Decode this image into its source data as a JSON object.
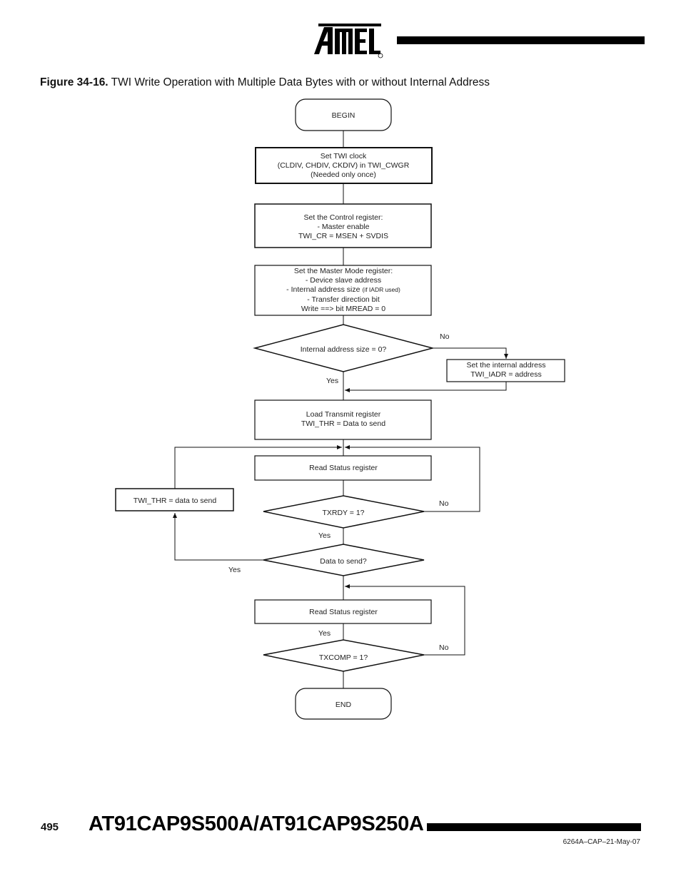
{
  "header": {
    "logo_text": "ATMEL",
    "logo_icon": "atmel-logo-icon",
    "registered_mark": "®"
  },
  "figure": {
    "label": "Figure 34-16.",
    "title": "TWI Write Operation with Multiple Data Bytes with or without Internal Address"
  },
  "flowchart": {
    "nodes": {
      "begin": {
        "type": "terminator",
        "lines": [
          "BEGIN"
        ]
      },
      "set_clock": {
        "type": "process",
        "lines": [
          "Set TWI clock",
          "(CLDIV, CHDIV, CKDIV) in TWI_CWGR",
          "(Needed only once)"
        ]
      },
      "set_control": {
        "type": "process",
        "lines": [
          "Set the Control register:",
          "- Master enable",
          "TWI_CR = MSEN + SVDIS"
        ]
      },
      "set_master_mode": {
        "type": "process",
        "lines": [
          "Set the Master Mode register:",
          "- Device slave address",
          "- Internal address size",
          "- Transfer direction bit",
          "Write ==> bit MREAD = 0"
        ],
        "small_note": "(if IADR used)"
      },
      "dec_internal_addr": {
        "type": "decision",
        "lines": [
          "Internal address size = 0?"
        ]
      },
      "set_internal_addr": {
        "type": "process",
        "lines": [
          "Set the internal address",
          "TWI_IADR = address"
        ]
      },
      "load_thr": {
        "type": "process",
        "lines": [
          "Load Transmit register",
          "TWI_THR = Data to send"
        ]
      },
      "read_status_1": {
        "type": "process",
        "lines": [
          "Read Status register"
        ]
      },
      "thr_data": {
        "type": "process",
        "lines": [
          "TWI_THR = data to send"
        ]
      },
      "dec_txrdy": {
        "type": "decision",
        "lines": [
          "TXRDY = 1?"
        ]
      },
      "dec_data_to_send": {
        "type": "decision",
        "lines": [
          "Data to send?"
        ]
      },
      "read_status_2": {
        "type": "process",
        "lines": [
          "Read Status register"
        ]
      },
      "dec_txcomp": {
        "type": "decision",
        "lines": [
          "TXCOMP = 1?"
        ]
      },
      "end": {
        "type": "terminator",
        "lines": [
          "END"
        ]
      }
    },
    "edge_labels": {
      "internal_addr_no": "No",
      "internal_addr_yes": "Yes",
      "txrdy_no": "No",
      "txrdy_yes": "Yes",
      "data_to_send_yes": "Yes",
      "txcomp_yes": "Yes",
      "txcomp_no": "No"
    }
  },
  "footer": {
    "page_number": "495",
    "doc_title": "AT91CAP9S500A/AT91CAP9S250A",
    "doc_id": "6264A–CAP–21-May-07"
  }
}
